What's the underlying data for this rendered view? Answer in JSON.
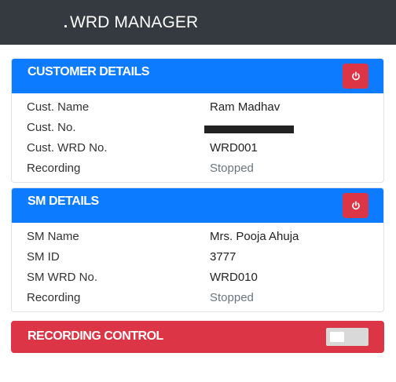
{
  "header": {
    "title": "WRD MANAGER"
  },
  "customer": {
    "title": "CUSTOMER DETAILS",
    "power_icon": "power-icon",
    "rows": [
      {
        "label": "Cust. Name",
        "value": "Ram Madhav"
      },
      {
        "label": "Cust. No.",
        "value": ""
      },
      {
        "label": "Cust. WRD No.",
        "value": "WRD001"
      },
      {
        "label": "Recording",
        "value": "Stopped"
      }
    ]
  },
  "sm": {
    "title": "SM DETAILS",
    "power_icon": "power-icon",
    "rows": [
      {
        "label": "SM Name",
        "value": "Mrs. Pooja Ahuja"
      },
      {
        "label": "SM ID",
        "value": "3777"
      },
      {
        "label": "SM WRD No.",
        "value": "WRD010"
      },
      {
        "label": "Recording",
        "value": "Stopped"
      }
    ]
  },
  "recording_control": {
    "title": "RECORDING CONTROL",
    "enabled": false
  },
  "colors": {
    "topbar": "#343a40",
    "card_header": "#0d7bff",
    "danger": "#dc3545",
    "muted_text": "#6c757d"
  }
}
